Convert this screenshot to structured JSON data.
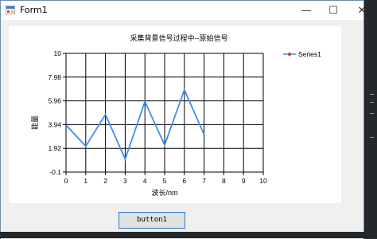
{
  "window": {
    "title": "Form1",
    "minimize_glyph": "—",
    "maximize_glyph": "☐",
    "close_glyph": "✕"
  },
  "chart_data": {
    "type": "line",
    "title": "采集背景信号过程中--原始信号",
    "xlabel": "波长/nm",
    "ylabel": "能量",
    "xlim": [
      0,
      10
    ],
    "ylim": [
      -0.1,
      10
    ],
    "x_ticks": [
      "0",
      "1",
      "2",
      "3",
      "4",
      "5",
      "6",
      "7",
      "8",
      "9",
      "10"
    ],
    "y_ticks": [
      "10",
      "7.98",
      "5.96",
      "3.94",
      "1.92",
      "-0.1"
    ],
    "grid": true,
    "legend_position": "top-right",
    "series": [
      {
        "name": "Series1",
        "color": "#418cf0",
        "x": [
          0,
          1,
          2,
          3,
          4,
          5,
          6,
          7
        ],
        "y": [
          3.9,
          2.1,
          4.8,
          1.0,
          5.9,
          2.2,
          6.9,
          3.1
        ]
      }
    ]
  },
  "form": {
    "button_label": "button1"
  }
}
